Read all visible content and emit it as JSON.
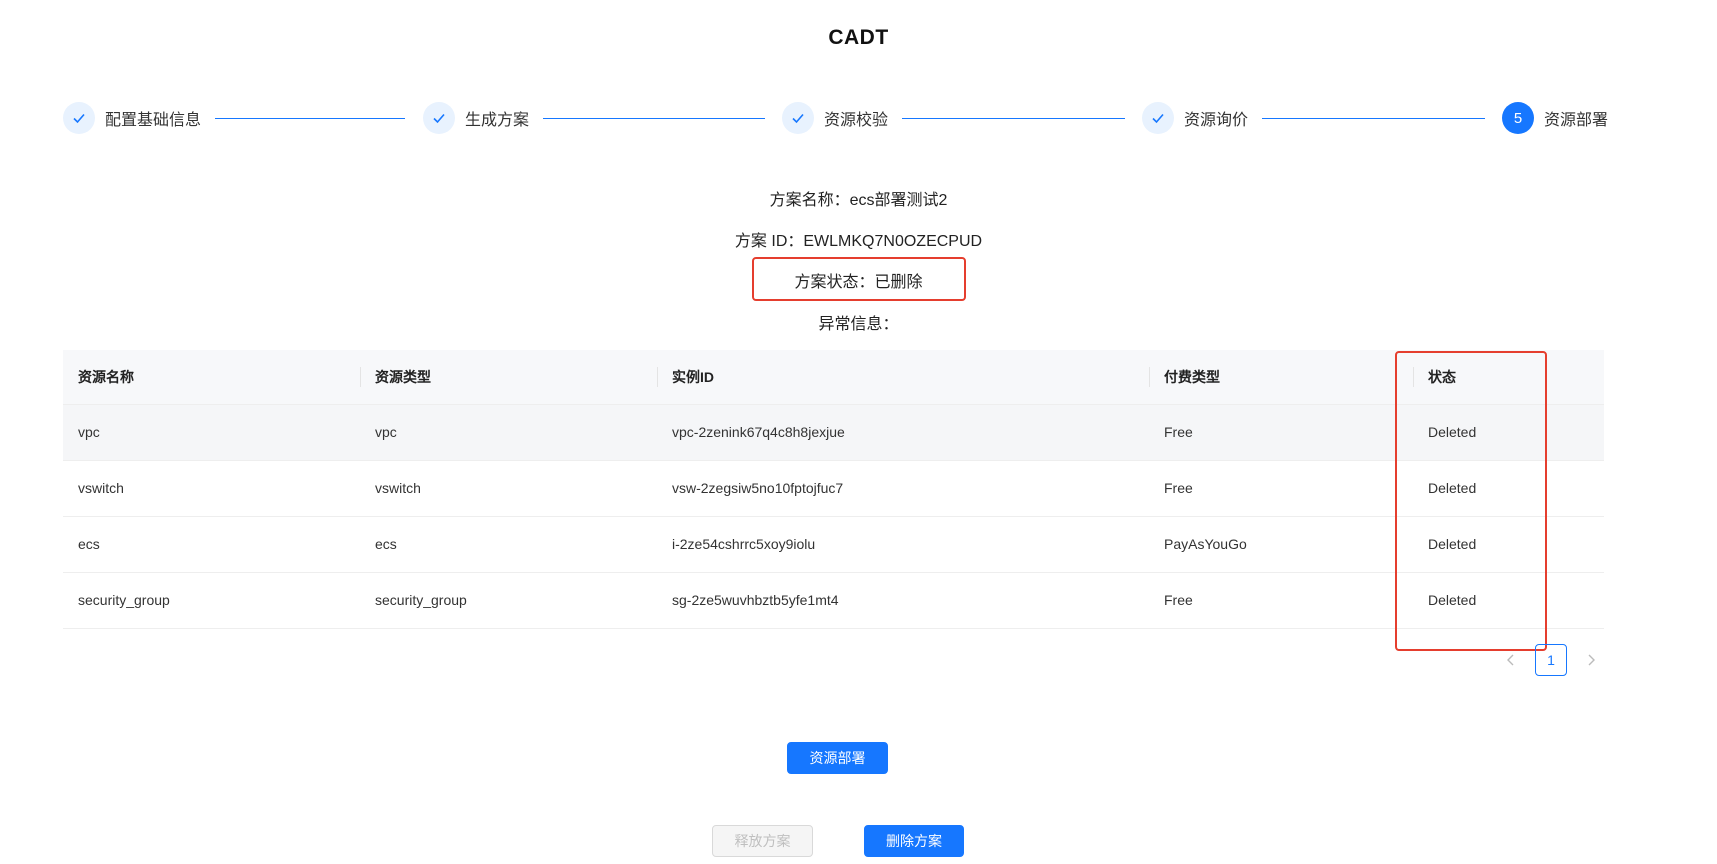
{
  "app": {
    "title": "CADT"
  },
  "steps": [
    {
      "label": "配置基础信息",
      "state": "done",
      "icon": "check-icon"
    },
    {
      "label": "生成方案",
      "state": "done",
      "icon": "check-icon"
    },
    {
      "label": "资源校验",
      "state": "done",
      "icon": "check-icon"
    },
    {
      "label": "资源询价",
      "state": "done",
      "icon": "check-icon"
    },
    {
      "label": "资源部署",
      "state": "active",
      "number": "5"
    }
  ],
  "info": {
    "name_label": "方案名称：",
    "name_value": "ecs部署测试2",
    "id_label": "方案 ID：",
    "id_value": "EWLMKQ7N0OZECPUD",
    "status_label": "方案状态：",
    "status_value": "已删除",
    "error_label": "异常信息："
  },
  "table": {
    "columns": [
      "资源名称",
      "资源类型",
      "实例ID",
      "付费类型",
      "状态"
    ],
    "rows": [
      [
        "vpc",
        "vpc",
        "vpc-2zenink67q4c8h8jexjue",
        "Free",
        "Deleted"
      ],
      [
        "vswitch",
        "vswitch",
        "vsw-2zegsiw5no10fptojfuc7",
        "Free",
        "Deleted"
      ],
      [
        "ecs",
        "ecs",
        "i-2ze54cshrrc5xoy9iolu",
        "PayAsYouGo",
        "Deleted"
      ],
      [
        "security_group",
        "security_group",
        "sg-2ze5wuvhbztb5yfe1mt4",
        "Free",
        "Deleted"
      ]
    ]
  },
  "pagination": {
    "current": "1",
    "prev_icon": "chevron-left-icon",
    "next_icon": "chevron-right-icon"
  },
  "buttons": {
    "deploy": "资源部署",
    "release": "释放方案",
    "delete": "删除方案"
  },
  "colors": {
    "primary": "#1677ff",
    "highlight": "#e53e2e"
  }
}
